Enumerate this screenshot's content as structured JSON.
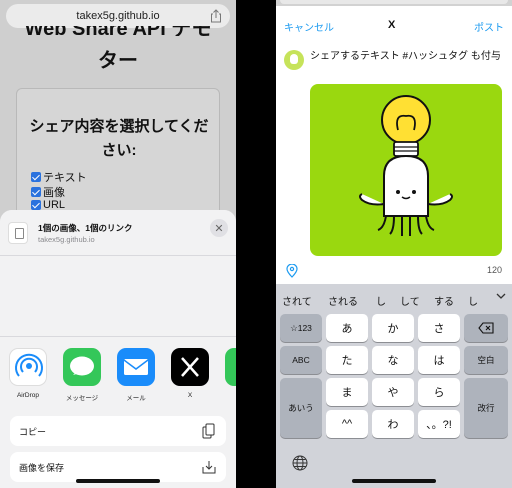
{
  "left": {
    "url": "takex5g.github.io",
    "heading_partial": "Web Share API デモ",
    "heading_line2": "ター",
    "card": {
      "title": "シェア内容を選択してください:",
      "options": [
        "テキスト",
        "画像",
        "URL"
      ]
    },
    "share_sheet": {
      "title": "1個の画像、1個のリンク",
      "subtitle": "takex5g.github.io",
      "apps": [
        {
          "name": "airdrop-icon",
          "label": "AirDrop",
          "color": "#ffffff"
        },
        {
          "name": "messages-icon",
          "label": "メッセージ",
          "color": "#34c759"
        },
        {
          "name": "mail-icon",
          "label": "メール",
          "color": "#1a8cfa"
        },
        {
          "name": "x-icon",
          "label": "X",
          "color": "#000000"
        }
      ],
      "actions": [
        {
          "label": "コピー",
          "icon": "copy-icon"
        },
        {
          "label": "画像を保存",
          "icon": "save-icon"
        }
      ]
    }
  },
  "right": {
    "cancel": "キャンセル",
    "logo": "X",
    "post": "ポスト",
    "tweet_text": "シェアするテキスト #ハッシュタグ も付与",
    "char_count": "120",
    "candidates": [
      "されて",
      "される",
      "し",
      "して",
      "する",
      "し"
    ],
    "keys": {
      "row1": [
        "☆123",
        "あ",
        "か",
        "さ"
      ],
      "row2": [
        "ABC",
        "た",
        "な",
        "は",
        "空白"
      ],
      "row3": [
        "あいう",
        "ま",
        "や",
        "ら",
        "改行"
      ],
      "row4": [
        "^^",
        "わ",
        "、。?!"
      ]
    },
    "accent": "#1d9bf0",
    "media_color": "#9ad80f"
  }
}
